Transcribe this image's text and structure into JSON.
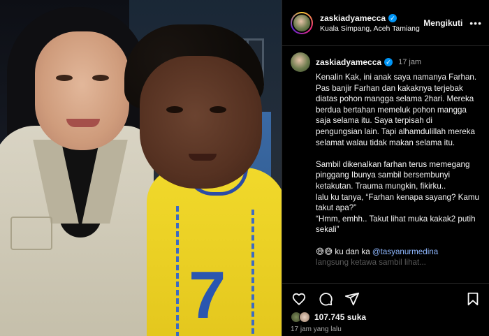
{
  "post": {
    "username": "zaskiadyamecca",
    "location": "Kuala Simpang, Aceh Tamiang",
    "follow_label": "Mengikuti",
    "more_label": "•••",
    "verified_mark": "✓"
  },
  "caption": {
    "username": "zaskiadyamecca",
    "time": "17 jam",
    "p1": "Kenalin Kak, ini anak saya namanya Farhan. Pas banjir Farhan dan kakaknya terjebak diatas pohon mangga selama 2hari. Mereka berdua bertahan memeluk pohon mangga saja selama itu. Saya terpisah di pengungsian lain. Tapi alhamdulillah mereka selamat walau tidak makan selama itu.",
    "p2_l1": "Sambil dikenalkan farhan terus memegang pinggang Ibunya sambil bersembunyi ketakutan. Trauma mungkin, fikirku..",
    "p2_l2": "lalu ku tanya, “Farhan kenapa sayang? Kamu takut apa?”",
    "p2_l3": "“Hmm, emhh.. Takut lihat muka kakak2 putih sekali”",
    "p3_emoji": "😅😅",
    "p3_text": " ku dan ka ",
    "p3_mention": "@tasyanurmedina",
    "p4_fade": "langsung ketawa sambil lihat..."
  },
  "photo": {
    "jersey_number": "7"
  },
  "actions": {
    "like_icon": "heart-icon",
    "comment_icon": "comment-icon",
    "share_icon": "share-icon",
    "save_icon": "bookmark-icon"
  },
  "stats": {
    "likes_count": "107.745",
    "likes_word": "suka",
    "time_ago": "17 jam yang lalu"
  },
  "colors": {
    "background": "#000000",
    "text": "#f5f5f5",
    "muted": "#a8a8a8",
    "link": "#8fb8ff",
    "verified": "#0095f6"
  }
}
